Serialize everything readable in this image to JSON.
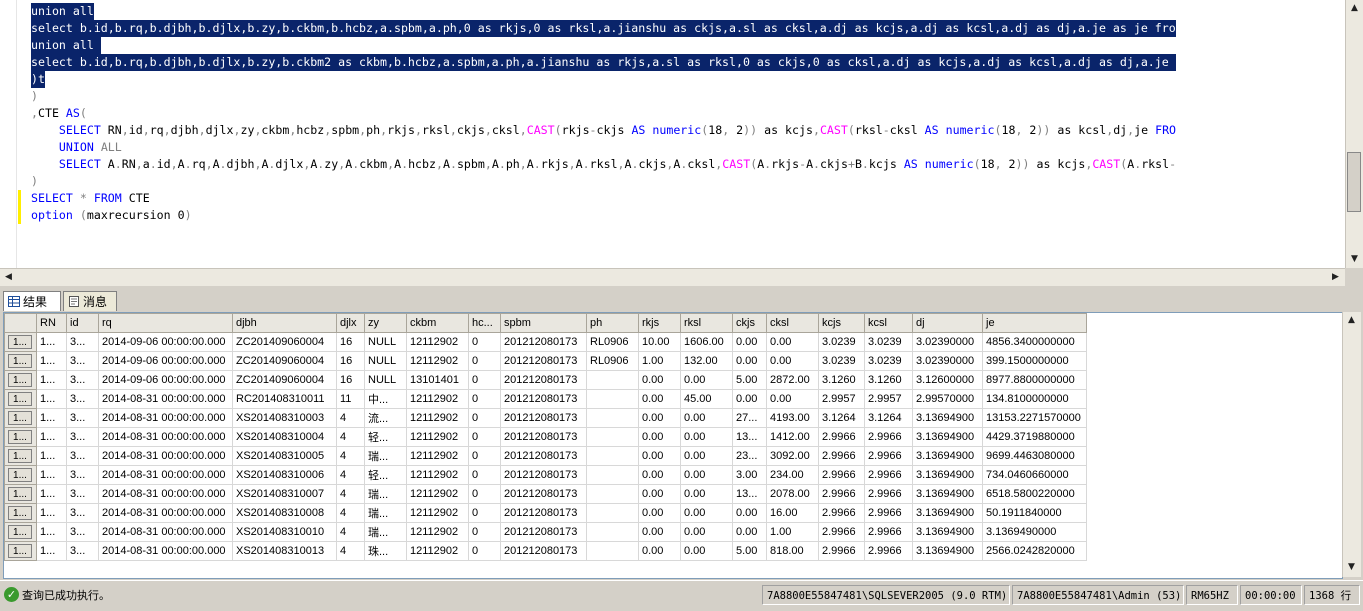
{
  "editor": {
    "lines": [
      {
        "selected": true,
        "parts": [
          {
            "c": "pl",
            "t": "union all"
          }
        ]
      },
      {
        "selected": true,
        "parts": [
          {
            "c": "pl",
            "t": "select b.id,b.rq,b.djbh,b.djlx,b.zy,b.ckbm,b.hcbz,a.spbm,a.ph,0 as rkjs,0 as rksl,a.jianshu as ckjs,a.sl as cksl,a.dj as kcjs,a.dj as kcsl,a.dj as dj,a.je as je fro"
          }
        ]
      },
      {
        "selected": true,
        "parts": [
          {
            "c": "pl",
            "t": "union all "
          }
        ]
      },
      {
        "selected": true,
        "parts": [
          {
            "c": "pl",
            "t": "select b.id,b.rq,b.djbh,b.djlx,b.zy,b.ckbm2 as ckbm,b.hcbz,a.spbm,a.ph,a.jianshu as rkjs,a.sl as rksl,0 as ckjs,0 as cksl,a.dj as kcjs,a.dj as kcsl,a.dj as dj,a.je "
          }
        ]
      },
      {
        "selected": true,
        "parts": [
          {
            "c": "pl",
            "t": ")t"
          }
        ]
      },
      {
        "selected": false,
        "parts": [
          {
            "c": "gr",
            "t": ")"
          }
        ]
      },
      {
        "selected": false,
        "parts": [
          {
            "c": "gr",
            "t": ","
          },
          {
            "c": "pl",
            "t": "CTE "
          },
          {
            "c": "kw",
            "t": "AS"
          },
          {
            "c": "gr",
            "t": "("
          }
        ]
      },
      {
        "selected": false,
        "parts": [
          {
            "c": "pl",
            "t": "    "
          },
          {
            "c": "kw",
            "t": "SELECT"
          },
          {
            "c": "pl",
            "t": " RN"
          },
          {
            "c": "gr",
            "t": ","
          },
          {
            "c": "pl",
            "t": "id"
          },
          {
            "c": "gr",
            "t": ","
          },
          {
            "c": "pl",
            "t": "rq"
          },
          {
            "c": "gr",
            "t": ","
          },
          {
            "c": "pl",
            "t": "djbh"
          },
          {
            "c": "gr",
            "t": ","
          },
          {
            "c": "pl",
            "t": "djlx"
          },
          {
            "c": "gr",
            "t": ","
          },
          {
            "c": "pl",
            "t": "zy"
          },
          {
            "c": "gr",
            "t": ","
          },
          {
            "c": "pl",
            "t": "ckbm"
          },
          {
            "c": "gr",
            "t": ","
          },
          {
            "c": "pl",
            "t": "hcbz"
          },
          {
            "c": "gr",
            "t": ","
          },
          {
            "c": "pl",
            "t": "spbm"
          },
          {
            "c": "gr",
            "t": ","
          },
          {
            "c": "pl",
            "t": "ph"
          },
          {
            "c": "gr",
            "t": ","
          },
          {
            "c": "pl",
            "t": "rkjs"
          },
          {
            "c": "gr",
            "t": ","
          },
          {
            "c": "pl",
            "t": "rksl"
          },
          {
            "c": "gr",
            "t": ","
          },
          {
            "c": "pl",
            "t": "ckjs"
          },
          {
            "c": "gr",
            "t": ","
          },
          {
            "c": "pl",
            "t": "cksl"
          },
          {
            "c": "gr",
            "t": ","
          },
          {
            "c": "fn",
            "t": "CAST"
          },
          {
            "c": "gr",
            "t": "("
          },
          {
            "c": "pl",
            "t": "rkjs"
          },
          {
            "c": "gr",
            "t": "-"
          },
          {
            "c": "pl",
            "t": "ckjs "
          },
          {
            "c": "kw",
            "t": "AS numeric"
          },
          {
            "c": "gr",
            "t": "("
          },
          {
            "c": "pl",
            "t": "18"
          },
          {
            "c": "gr",
            "t": ","
          },
          {
            "c": "pl",
            "t": " 2"
          },
          {
            "c": "gr",
            "t": "))"
          },
          {
            "c": "pl",
            "t": " as kcjs"
          },
          {
            "c": "gr",
            "t": ","
          },
          {
            "c": "fn",
            "t": "CAST"
          },
          {
            "c": "gr",
            "t": "("
          },
          {
            "c": "pl",
            "t": "rksl"
          },
          {
            "c": "gr",
            "t": "-"
          },
          {
            "c": "pl",
            "t": "cksl "
          },
          {
            "c": "kw",
            "t": "AS numeric"
          },
          {
            "c": "gr",
            "t": "("
          },
          {
            "c": "pl",
            "t": "18"
          },
          {
            "c": "gr",
            "t": ","
          },
          {
            "c": "pl",
            "t": " 2"
          },
          {
            "c": "gr",
            "t": "))"
          },
          {
            "c": "pl",
            "t": " as kcsl"
          },
          {
            "c": "gr",
            "t": ","
          },
          {
            "c": "pl",
            "t": "dj"
          },
          {
            "c": "gr",
            "t": ","
          },
          {
            "c": "pl",
            "t": "je "
          },
          {
            "c": "kw",
            "t": "FRO"
          }
        ]
      },
      {
        "selected": false,
        "parts": [
          {
            "c": "pl",
            "t": "    "
          },
          {
            "c": "kw",
            "t": "UNION"
          },
          {
            "c": "pl",
            "t": " "
          },
          {
            "c": "gr",
            "t": "ALL"
          }
        ]
      },
      {
        "selected": false,
        "parts": [
          {
            "c": "pl",
            "t": "    "
          },
          {
            "c": "kw",
            "t": "SELECT"
          },
          {
            "c": "pl",
            "t": " A"
          },
          {
            "c": "gr",
            "t": "."
          },
          {
            "c": "pl",
            "t": "RN"
          },
          {
            "c": "gr",
            "t": ","
          },
          {
            "c": "pl",
            "t": "a"
          },
          {
            "c": "gr",
            "t": "."
          },
          {
            "c": "pl",
            "t": "id"
          },
          {
            "c": "gr",
            "t": ","
          },
          {
            "c": "pl",
            "t": "A"
          },
          {
            "c": "gr",
            "t": "."
          },
          {
            "c": "pl",
            "t": "rq"
          },
          {
            "c": "gr",
            "t": ","
          },
          {
            "c": "pl",
            "t": "A"
          },
          {
            "c": "gr",
            "t": "."
          },
          {
            "c": "pl",
            "t": "djbh"
          },
          {
            "c": "gr",
            "t": ","
          },
          {
            "c": "pl",
            "t": "A"
          },
          {
            "c": "gr",
            "t": "."
          },
          {
            "c": "pl",
            "t": "djlx"
          },
          {
            "c": "gr",
            "t": ","
          },
          {
            "c": "pl",
            "t": "A"
          },
          {
            "c": "gr",
            "t": "."
          },
          {
            "c": "pl",
            "t": "zy"
          },
          {
            "c": "gr",
            "t": ","
          },
          {
            "c": "pl",
            "t": "A"
          },
          {
            "c": "gr",
            "t": "."
          },
          {
            "c": "pl",
            "t": "ckbm"
          },
          {
            "c": "gr",
            "t": ","
          },
          {
            "c": "pl",
            "t": "A"
          },
          {
            "c": "gr",
            "t": "."
          },
          {
            "c": "pl",
            "t": "hcbz"
          },
          {
            "c": "gr",
            "t": ","
          },
          {
            "c": "pl",
            "t": "A"
          },
          {
            "c": "gr",
            "t": "."
          },
          {
            "c": "pl",
            "t": "spbm"
          },
          {
            "c": "gr",
            "t": ","
          },
          {
            "c": "pl",
            "t": "A"
          },
          {
            "c": "gr",
            "t": "."
          },
          {
            "c": "pl",
            "t": "ph"
          },
          {
            "c": "gr",
            "t": ","
          },
          {
            "c": "pl",
            "t": "A"
          },
          {
            "c": "gr",
            "t": "."
          },
          {
            "c": "pl",
            "t": "rkjs"
          },
          {
            "c": "gr",
            "t": ","
          },
          {
            "c": "pl",
            "t": "A"
          },
          {
            "c": "gr",
            "t": "."
          },
          {
            "c": "pl",
            "t": "rksl"
          },
          {
            "c": "gr",
            "t": ","
          },
          {
            "c": "pl",
            "t": "A"
          },
          {
            "c": "gr",
            "t": "."
          },
          {
            "c": "pl",
            "t": "ckjs"
          },
          {
            "c": "gr",
            "t": ","
          },
          {
            "c": "pl",
            "t": "A"
          },
          {
            "c": "gr",
            "t": "."
          },
          {
            "c": "pl",
            "t": "cksl"
          },
          {
            "c": "gr",
            "t": ","
          },
          {
            "c": "fn",
            "t": "CAST"
          },
          {
            "c": "gr",
            "t": "("
          },
          {
            "c": "pl",
            "t": "A"
          },
          {
            "c": "gr",
            "t": "."
          },
          {
            "c": "pl",
            "t": "rkjs"
          },
          {
            "c": "gr",
            "t": "-"
          },
          {
            "c": "pl",
            "t": "A"
          },
          {
            "c": "gr",
            "t": "."
          },
          {
            "c": "pl",
            "t": "ckjs"
          },
          {
            "c": "gr",
            "t": "+"
          },
          {
            "c": "pl",
            "t": "B"
          },
          {
            "c": "gr",
            "t": "."
          },
          {
            "c": "pl",
            "t": "kcjs "
          },
          {
            "c": "kw",
            "t": "AS numeric"
          },
          {
            "c": "gr",
            "t": "("
          },
          {
            "c": "pl",
            "t": "18"
          },
          {
            "c": "gr",
            "t": ","
          },
          {
            "c": "pl",
            "t": " 2"
          },
          {
            "c": "gr",
            "t": "))"
          },
          {
            "c": "pl",
            "t": " as kcjs"
          },
          {
            "c": "gr",
            "t": ","
          },
          {
            "c": "fn",
            "t": "CAST"
          },
          {
            "c": "gr",
            "t": "("
          },
          {
            "c": "pl",
            "t": "A"
          },
          {
            "c": "gr",
            "t": "."
          },
          {
            "c": "pl",
            "t": "rksl"
          },
          {
            "c": "gr",
            "t": "-"
          }
        ]
      },
      {
        "selected": false,
        "parts": [
          {
            "c": "gr",
            "t": ")"
          }
        ]
      },
      {
        "selected": false,
        "mark": true,
        "parts": [
          {
            "c": "kw",
            "t": "SELECT"
          },
          {
            "c": "pl",
            "t": " "
          },
          {
            "c": "gr",
            "t": "*"
          },
          {
            "c": "pl",
            "t": " "
          },
          {
            "c": "kw",
            "t": "FROM"
          },
          {
            "c": "pl",
            "t": " CTE"
          }
        ]
      },
      {
        "selected": false,
        "mark": true,
        "parts": [
          {
            "c": "kw",
            "t": "option"
          },
          {
            "c": "pl",
            "t": " "
          },
          {
            "c": "gr",
            "t": "("
          },
          {
            "c": "pl",
            "t": "maxrecursion 0"
          },
          {
            "c": "gr",
            "t": ")"
          }
        ]
      }
    ]
  },
  "tabs": [
    {
      "label": "结果",
      "active": true
    },
    {
      "label": "消息",
      "active": false
    }
  ],
  "grid": {
    "columns": [
      "",
      "RN",
      "id",
      "rq",
      "djbh",
      "djlx",
      "zy",
      "ckbm",
      "hc...",
      "spbm",
      "ph",
      "rkjs",
      "rksl",
      "ckjs",
      "cksl",
      "kcjs",
      "kcsl",
      "dj",
      "je"
    ],
    "rows": [
      [
        "1...",
        "1...",
        "3...",
        "2014-09-06 00:00:00.000",
        "ZC201409060004",
        "16",
        "NULL",
        "12112902",
        "0",
        "201212080173",
        "RL0906",
        "10.00",
        "1606.00",
        "0.00",
        "0.00",
        "3.0239",
        "3.0239",
        "3.02390000",
        "4856.3400000000"
      ],
      [
        "1...",
        "1...",
        "3...",
        "2014-09-06 00:00:00.000",
        "ZC201409060004",
        "16",
        "NULL",
        "12112902",
        "0",
        "201212080173",
        "RL0906",
        "1.00",
        "132.00",
        "0.00",
        "0.00",
        "3.0239",
        "3.0239",
        "3.02390000",
        "399.1500000000"
      ],
      [
        "1...",
        "1...",
        "3...",
        "2014-09-06 00:00:00.000",
        "ZC201409060004",
        "16",
        "NULL",
        "13101401",
        "0",
        "201212080173",
        "",
        "0.00",
        "0.00",
        "5.00",
        "2872.00",
        "3.1260",
        "3.1260",
        "3.12600000",
        "8977.8800000000"
      ],
      [
        "1...",
        "1...",
        "3...",
        "2014-08-31 00:00:00.000",
        "RC201408310011",
        "11",
        "中...",
        "12112902",
        "0",
        "201212080173",
        "",
        "0.00",
        "45.00",
        "0.00",
        "0.00",
        "2.9957",
        "2.9957",
        "2.99570000",
        "134.8100000000"
      ],
      [
        "1...",
        "1...",
        "3...",
        "2014-08-31 00:00:00.000",
        "XS201408310003",
        "4",
        "流...",
        "12112902",
        "0",
        "201212080173",
        "",
        "0.00",
        "0.00",
        "27...",
        "4193.00",
        "3.1264",
        "3.1264",
        "3.13694900",
        "13153.2271570000"
      ],
      [
        "1...",
        "1...",
        "3...",
        "2014-08-31 00:00:00.000",
        "XS201408310004",
        "4",
        "轻...",
        "12112902",
        "0",
        "201212080173",
        "",
        "0.00",
        "0.00",
        "13...",
        "1412.00",
        "2.9966",
        "2.9966",
        "3.13694900",
        "4429.3719880000"
      ],
      [
        "1...",
        "1...",
        "3...",
        "2014-08-31 00:00:00.000",
        "XS201408310005",
        "4",
        "瑞...",
        "12112902",
        "0",
        "201212080173",
        "",
        "0.00",
        "0.00",
        "23...",
        "3092.00",
        "2.9966",
        "2.9966",
        "3.13694900",
        "9699.4463080000"
      ],
      [
        "1...",
        "1...",
        "3...",
        "2014-08-31 00:00:00.000",
        "XS201408310006",
        "4",
        "轻...",
        "12112902",
        "0",
        "201212080173",
        "",
        "0.00",
        "0.00",
        "3.00",
        "234.00",
        "2.9966",
        "2.9966",
        "3.13694900",
        "734.0460660000"
      ],
      [
        "1...",
        "1...",
        "3...",
        "2014-08-31 00:00:00.000",
        "XS201408310007",
        "4",
        "瑞...",
        "12112902",
        "0",
        "201212080173",
        "",
        "0.00",
        "0.00",
        "13...",
        "2078.00",
        "2.9966",
        "2.9966",
        "3.13694900",
        "6518.5800220000"
      ],
      [
        "1...",
        "1...",
        "3...",
        "2014-08-31 00:00:00.000",
        "XS201408310008",
        "4",
        "瑞...",
        "12112902",
        "0",
        "201212080173",
        "",
        "0.00",
        "0.00",
        "0.00",
        "16.00",
        "2.9966",
        "2.9966",
        "3.13694900",
        "50.1911840000"
      ],
      [
        "1...",
        "1...",
        "3...",
        "2014-08-31 00:00:00.000",
        "XS201408310010",
        "4",
        "瑞...",
        "12112902",
        "0",
        "201212080173",
        "",
        "0.00",
        "0.00",
        "0.00",
        "1.00",
        "2.9966",
        "2.9966",
        "3.13694900",
        "3.1369490000"
      ],
      [
        "1...",
        "1...",
        "3...",
        "2014-08-31 00:00:00.000",
        "XS201408310013",
        "4",
        "珠...",
        "12112902",
        "0",
        "201212080173",
        "",
        "0.00",
        "0.00",
        "5.00",
        "818.00",
        "2.9966",
        "2.9966",
        "3.13694900",
        "2566.0242820000"
      ]
    ]
  },
  "status": {
    "message": "查询已成功执行。",
    "server": "7A8800E55847481\\SQLSEVER2005 (9.0 RTM)",
    "user": "7A8800E55847481\\Admin (53)",
    "db": "RM65HZ",
    "time": "00:00:00",
    "rows": "1368 行"
  },
  "colors": {
    "selection": "#0a246a",
    "keyword": "#0000ff",
    "function": "#ff00ff",
    "operator": "#808080"
  }
}
